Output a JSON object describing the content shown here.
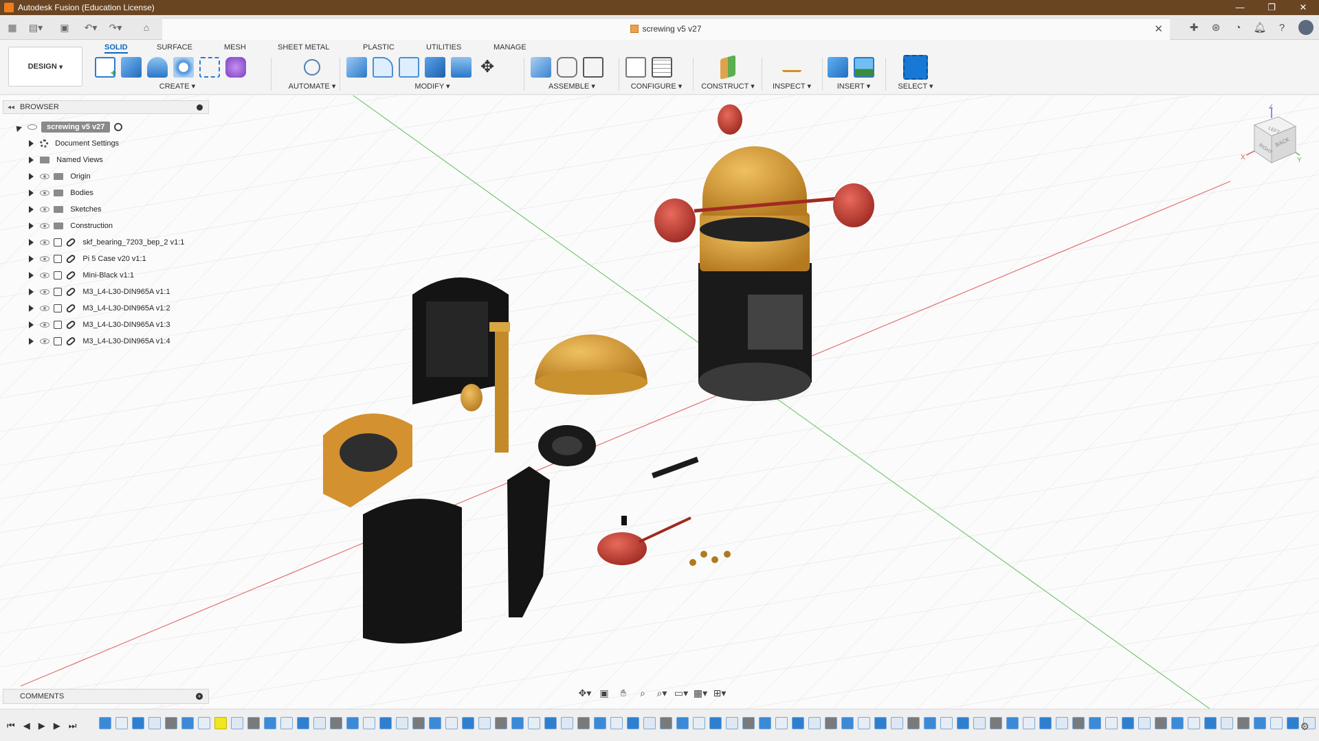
{
  "window": {
    "title": "Autodesk Fusion (Education License)",
    "controls": [
      "—",
      "❐",
      "✕"
    ]
  },
  "document": {
    "tab_title": "screwing v5 v27"
  },
  "workspace": {
    "mode_label": "DESIGN",
    "tabs": [
      "SOLID",
      "SURFACE",
      "MESH",
      "SHEET METAL",
      "PLASTIC",
      "UTILITIES",
      "MANAGE"
    ],
    "active_tab": "SOLID",
    "groups": [
      {
        "label": "CREATE"
      },
      {
        "label": "AUTOMATE"
      },
      {
        "label": "MODIFY"
      },
      {
        "label": "ASSEMBLE"
      },
      {
        "label": "CONFIGURE"
      },
      {
        "label": "CONSTRUCT"
      },
      {
        "label": "INSPECT"
      },
      {
        "label": "INSERT"
      },
      {
        "label": "SELECT"
      }
    ]
  },
  "browser": {
    "header": "BROWSER",
    "root": "screwing v5 v27",
    "items": [
      {
        "label": "Document Settings",
        "icon": "gear-icon"
      },
      {
        "label": "Named Views",
        "icon": "folder-icon"
      },
      {
        "label": "Origin",
        "icon": "folder-icon"
      },
      {
        "label": "Bodies",
        "icon": "folder-icon"
      },
      {
        "label": "Sketches",
        "icon": "folder-icon"
      },
      {
        "label": "Construction",
        "icon": "folder-icon"
      },
      {
        "label": "skf_bearing_7203_bep_2 v1:1",
        "icon": "component-link-icon"
      },
      {
        "label": "Pi 5 Case v20 v1:1",
        "icon": "component-link-icon"
      },
      {
        "label": "Mini-Black v1:1",
        "icon": "component-link-icon"
      },
      {
        "label": "M3_L4-L30-DIN965A v1:1",
        "icon": "component-link-icon"
      },
      {
        "label": "M3_L4-L30-DIN965A v1:2",
        "icon": "component-link-icon"
      },
      {
        "label": "M3_L4-L30-DIN965A v1:3",
        "icon": "component-link-icon"
      },
      {
        "label": "M3_L4-L30-DIN965A v1:4",
        "icon": "component-link-icon"
      }
    ]
  },
  "comments": {
    "header": "COMMENTS"
  },
  "viewcube": {
    "faces": [
      "LEFT",
      "RIGHT",
      "BACK"
    ],
    "axes": [
      "Z",
      "X",
      "Y"
    ]
  },
  "colors": {
    "titlebar": "#6a4523",
    "accent": "#0a67c2",
    "body_orange": "#d79a36",
    "body_black": "#151515",
    "body_red": "#b8352d"
  }
}
